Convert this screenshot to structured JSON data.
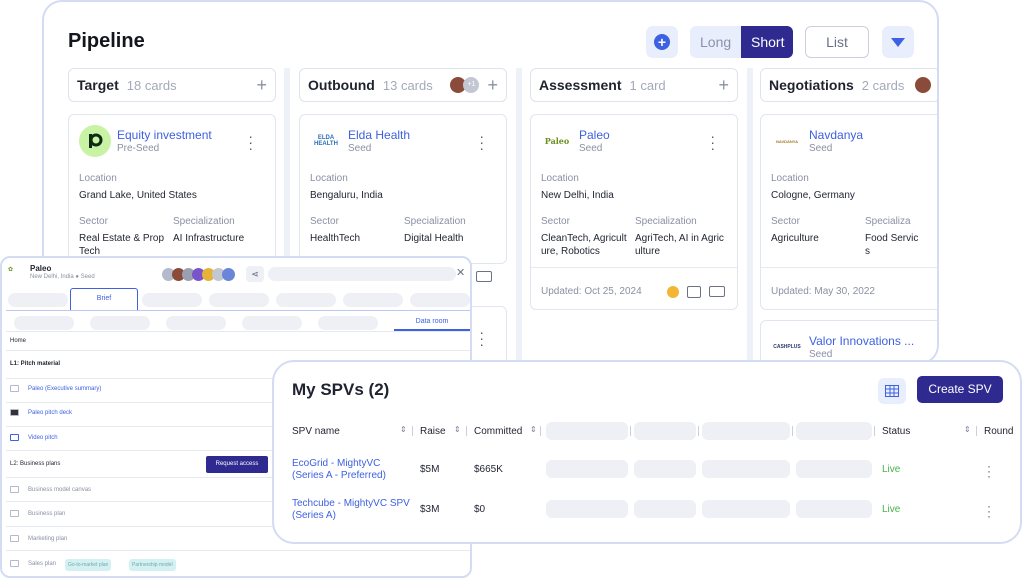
{
  "pipeline": {
    "title": "Pipeline",
    "view_long": "Long",
    "view_short": "Short",
    "list_label": "List",
    "columns": [
      {
        "name": "Target",
        "count": "18 cards"
      },
      {
        "name": "Outbound",
        "count": "13 cards",
        "extra": "+1"
      },
      {
        "name": "Assessment",
        "count": "1 card"
      },
      {
        "name": "Negotiations",
        "count": "2 cards"
      }
    ],
    "cards": [
      {
        "company": "Equity investment",
        "stage": "Pre-Seed",
        "location_label": "Location",
        "location": "Grand Lake, United States",
        "sector_label": "Sector",
        "sector": "Real Estate & Prop Tech",
        "spec_label": "Specialization",
        "spec": "AI Infrastructure"
      },
      {
        "company": "Elda Health",
        "stage": "Seed",
        "location_label": "Location",
        "location": "Bengaluru, India",
        "sector_label": "Sector",
        "sector": "HealthTech",
        "spec_label": "Specialization",
        "spec": "Digital Health",
        "logo": "ELDA HEALTH"
      },
      {
        "company": "Paleo",
        "stage": "Seed",
        "location_label": "Location",
        "location": "New Delhi, India",
        "sector_label": "Sector",
        "sector": "CleanTech, Agricult ure, Robotics",
        "spec_label": "Specialization",
        "spec": "AgriTech, AI in Agric ulture",
        "updated": "Updated: Oct 25, 2024",
        "logo": "Paleo"
      },
      {
        "company": "Navdanya",
        "stage": "Seed",
        "location_label": "Location",
        "location": "Cologne, Germany",
        "sector_label": "Sector",
        "sector": "Agriculture",
        "spec_label": "Specializa",
        "spec": "Food Servic s",
        "updated": "Updated: May 30, 2022",
        "logo": "NAVDANYA"
      },
      {
        "company": "Valor Innovations ...",
        "stage": "Seed",
        "logo": "CASHPLUS"
      }
    ]
  },
  "brief": {
    "company": "Paleo",
    "meta": "New Delhi, India  ●  Seed",
    "tab_active": "Brief",
    "data_room": "Data room",
    "home": "Home",
    "l1": "L1: Pitch material",
    "items1": [
      "Paleo (Executive summary)",
      "Paleo pitch deck",
      "Video pitch"
    ],
    "l2": "L2: Business plans",
    "request": "Request access",
    "items2": [
      "Business model canvas",
      "Business plan",
      "Marketing plan",
      "Sales plan"
    ],
    "tags": [
      "Go-to-market plan",
      "Partnership model"
    ]
  },
  "spv": {
    "title": "My SPVs (2)",
    "create": "Create SPV",
    "headers": {
      "name": "SPV name",
      "raise": "Raise",
      "committed": "Committed",
      "status": "Status",
      "round": "Round"
    },
    "rows": [
      {
        "name": "EcoGrid - MightyVC (Series A - Preferred)",
        "raise": "$5M",
        "committed": "$665K",
        "status": "Live"
      },
      {
        "name": "Techcube - MightyVC SPV (Series A)",
        "raise": "$3M",
        "committed": "$0",
        "status": "Live"
      }
    ]
  }
}
